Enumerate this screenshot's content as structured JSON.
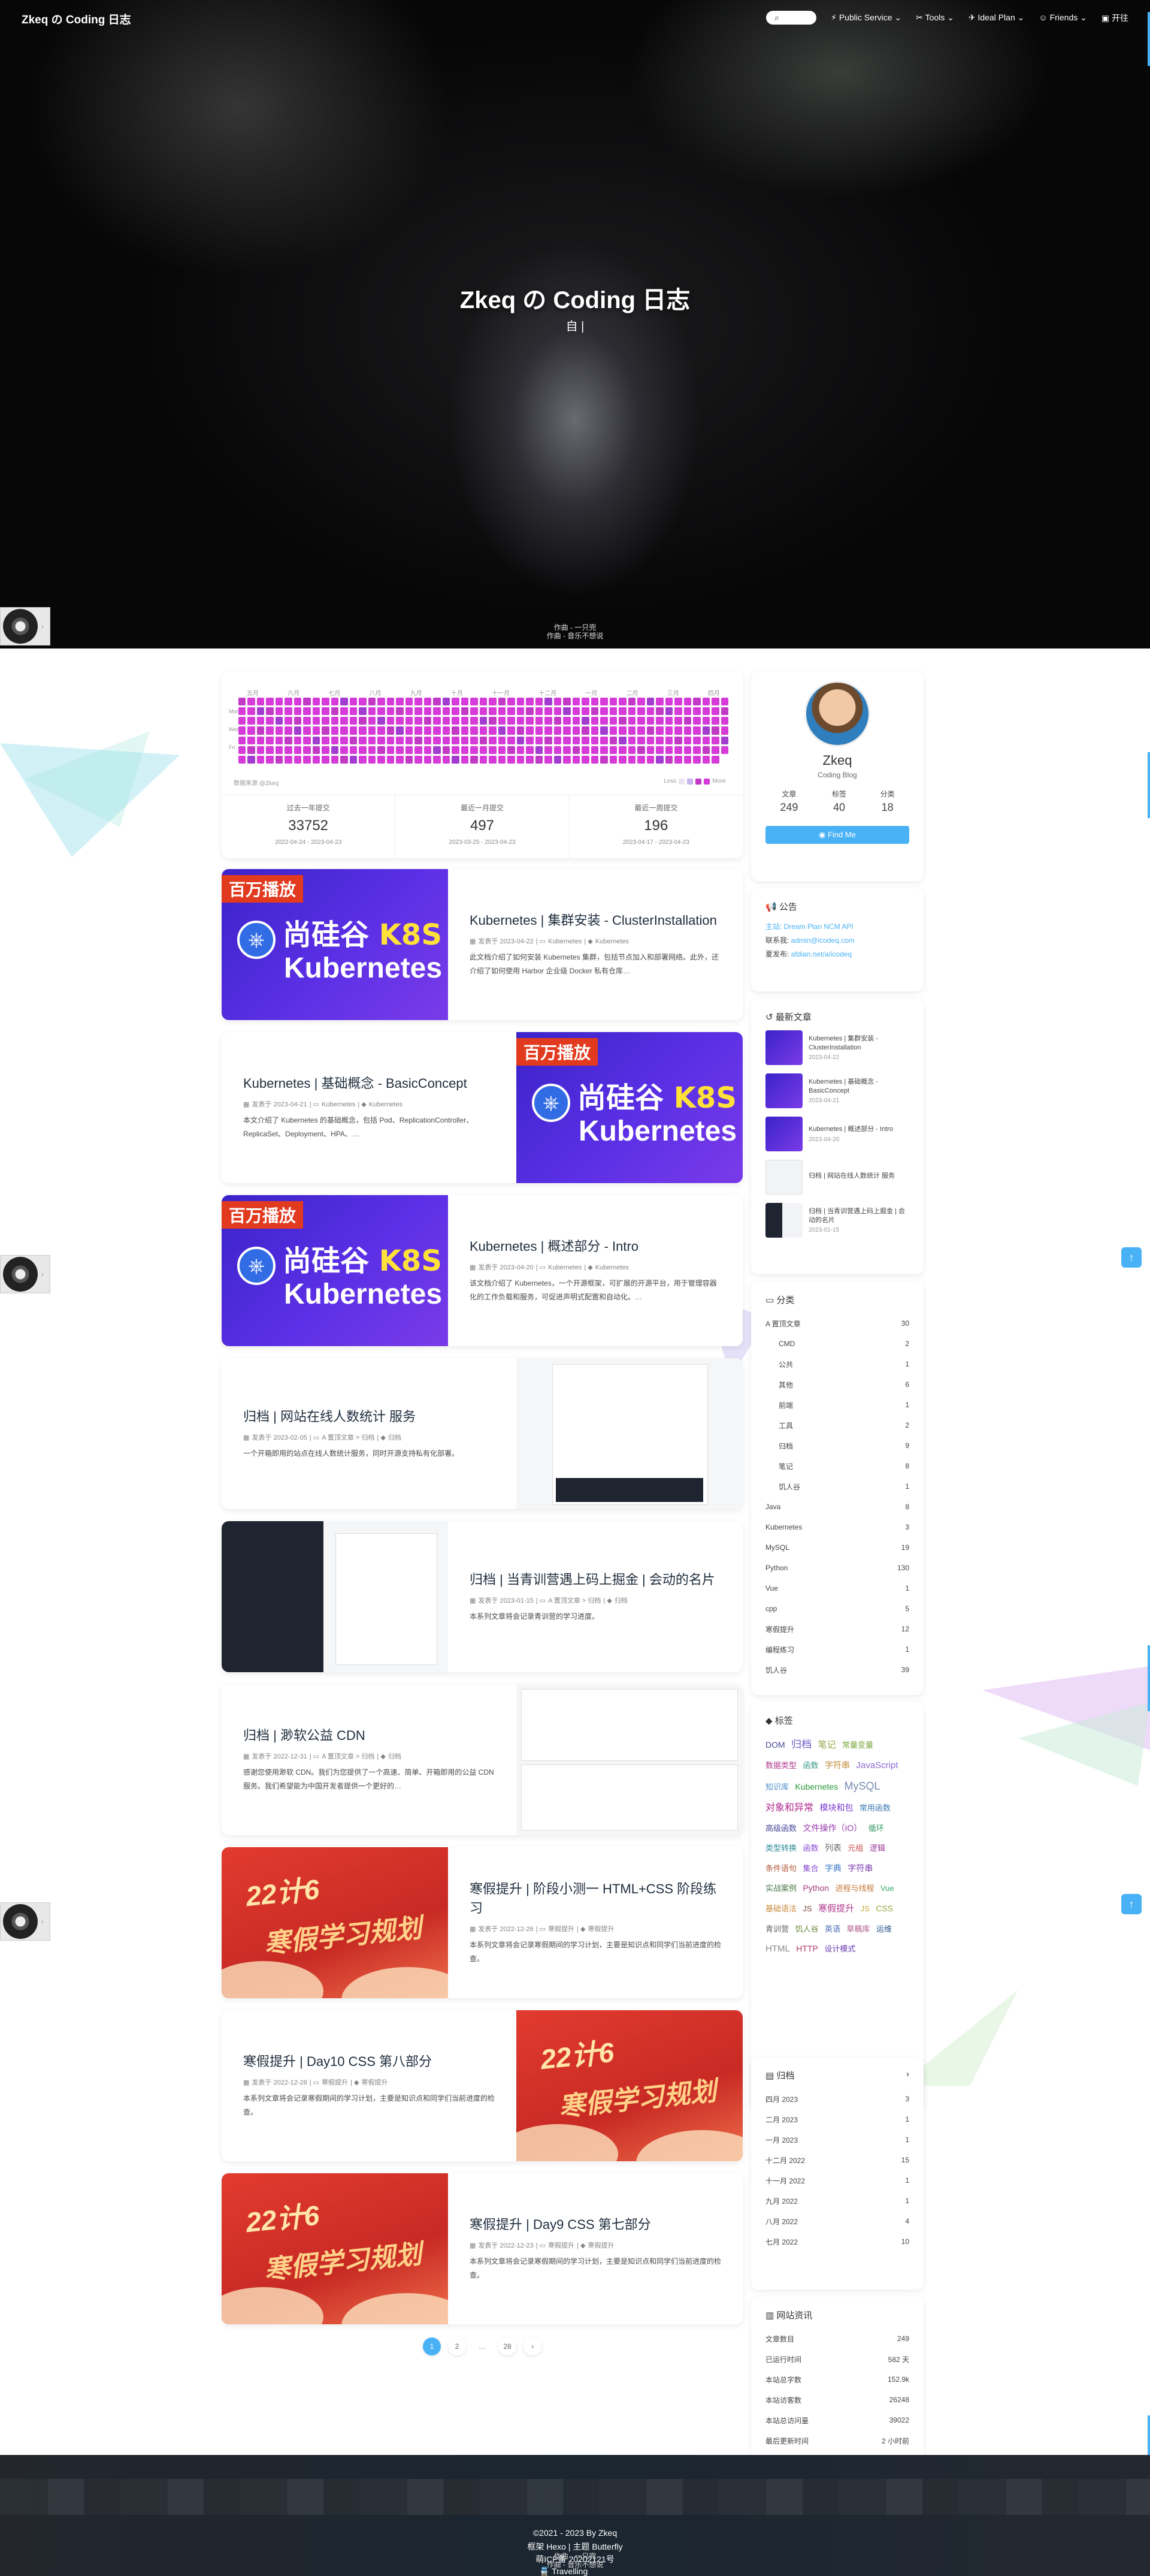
{
  "nav": {
    "site_name": "Zkeq の Coding 日志",
    "search": "Search",
    "menus": [
      "Public Service",
      "Tools",
      "Ideal Plan",
      "Friends",
      "开往"
    ]
  },
  "hero": {
    "title": "Zkeq の Coding 日志",
    "subtitle": "自 |",
    "foot1": "作曲 - 一只兜",
    "foot2": "作曲 - 音乐不想说"
  },
  "heatmap": {
    "months": [
      "五月",
      "六月",
      "七月",
      "八月",
      "九月",
      "十月",
      "十一月",
      "十二月",
      "一月",
      "二月",
      "三月",
      "四月"
    ],
    "days": [
      "Mon",
      "Wed",
      "Fri"
    ],
    "source": "数据来源 @Zkeq",
    "less": "Less",
    "more": "More",
    "stats": [
      {
        "title": "过去一年提交",
        "value": "33752",
        "range": "2022-04-24 - 2023-04-23"
      },
      {
        "title": "最近一月提交",
        "value": "497",
        "range": "2023-03-25 - 2023-04-23"
      },
      {
        "title": "最近一周提交",
        "value": "196",
        "range": "2023-04-17 - 2023-04-23"
      }
    ]
  },
  "posts": [
    {
      "title": "Kubernetes | 集群安装 - ClusterInstallation",
      "date": "发表于 2023-04-22",
      "cat": "Kubernetes",
      "tag": "Kubernetes",
      "excerpt": "此文档介绍了如何安装 Kubernetes 集群，包括节点加入和部署网络。此外，还介绍了如何使用 Harbor 企业级 Docker 私有仓库…"
    },
    {
      "title": "Kubernetes | 基础概念 - BasicConcept",
      "date": "发表于 2023-04-21",
      "cat": "Kubernetes",
      "tag": "Kubernetes",
      "excerpt": "本文介绍了 Kubernetes 的基础概念，包括 Pod、ReplicationController、ReplicaSet、Deployment、HPA、…"
    },
    {
      "title": "Kubernetes | 概述部分 - Intro",
      "date": "发表于 2023-04-20",
      "cat": "Kubernetes",
      "tag": "Kubernetes",
      "excerpt": "该文档介绍了 Kubernetes，一个开源框架，可扩展的开源平台，用于管理容器化的工作负载和服务，可促进声明式配置和自动化。…"
    },
    {
      "title": "归档 | 网站在线人数统计 服务",
      "date": "发表于 2023-02-05",
      "cat": "A 置顶文章 > 归档",
      "tag": "归档",
      "excerpt": "一个开箱即用的站点在线人数统计服务，同时开源支持私有化部署。"
    },
    {
      "title": "归档 | 当青训营遇上码上掘金 | 会动的名片",
      "date": "发表于 2023-01-15",
      "cat": "A 置顶文章 > 归档",
      "tag": "归档",
      "excerpt": "本系列文章将会记录青训营的学习进度。"
    },
    {
      "title": "归档 | 渺软公益 CDN",
      "date": "发表于 2022-12-31",
      "cat": "A 置顶文章 > 归档",
      "tag": "归档",
      "excerpt": "感谢您使用渺软 CDN。我们为您提供了一个高速、简单、开箱即用的公益 CDN 服务。我们希望能为中国开发者提供一个更好的…"
    },
    {
      "title": "寒假提升 | 阶段小测一 HTML+CSS 阶段练习",
      "date": "发表于 2022-12-26",
      "cat": "寒假提升",
      "tag": "寒假提升",
      "excerpt": "本系列文章将会记录寒假期间的学习计划，主要是知识点和同学们当前进度的检查。"
    },
    {
      "title": "寒假提升 | Day10 CSS 第八部分",
      "date": "发表于 2022-12-28",
      "cat": "寒假提升",
      "tag": "寒假提升",
      "excerpt": "本系列文章将会记录寒假期间的学习计划，主要是知识点和同学们当前进度的检查。"
    },
    {
      "title": "寒假提升 | Day9 CSS 第七部分",
      "date": "发表于 2022-12-23",
      "cat": "寒假提升",
      "tag": "寒假提升",
      "excerpt": "本系列文章将会记录寒假期间的学习计划，主要是知识点和同学们当前进度的检查。"
    }
  ],
  "images": {
    "k8s_badge": "百万播放",
    "k8s_brand": "尚硅谷",
    "k8s_title": "K8S",
    "k8s_sub": "Kubernetes",
    "winter1": "22计6",
    "winter2": "寒假学习规划"
  },
  "pager": [
    "1",
    "2",
    "…",
    "28",
    "›"
  ],
  "author": {
    "name": "Zkeq",
    "desc": "Coding Blog",
    "stats": [
      {
        "label": "文章",
        "value": "249"
      },
      {
        "label": "标签",
        "value": "40"
      },
      {
        "label": "分类",
        "value": "18"
      }
    ],
    "follow": "Find Me"
  },
  "announcement": {
    "title": "公告",
    "line1": "主站: Dream Plan  NCM API",
    "line2_label": "联系我: ",
    "line2": "admin@icodeq.com",
    "line3_label": "夏发布: ",
    "line3": "afdian.net/a/icodeq"
  },
  "recent": {
    "title": "最新文章",
    "items": [
      {
        "title": "Kubernetes | 集群安装 - ClusterInstallation",
        "date": "2023-04-22"
      },
      {
        "title": "Kubernetes | 基础概念 - BasicConcept",
        "date": "2023-04-21"
      },
      {
        "title": "Kubernetes | 概述部分 - Intro",
        "date": "2023-04-20"
      },
      {
        "title": "归档 | 网站在线人数统计 服务",
        "date": ""
      },
      {
        "title": "归档 | 当青训营遇上码上掘金 | 会动的名片",
        "date": "2023-01-15"
      }
    ]
  },
  "categories": {
    "title": "分类",
    "items": [
      {
        "name": "A 置顶文章",
        "count": "30",
        "sub": false
      },
      {
        "name": "CMD",
        "count": "2",
        "sub": true
      },
      {
        "name": "公共",
        "count": "1",
        "sub": true
      },
      {
        "name": "其他",
        "count": "6",
        "sub": true
      },
      {
        "name": "前端",
        "count": "1",
        "sub": true
      },
      {
        "name": "工具",
        "count": "2",
        "sub": true
      },
      {
        "name": "归档",
        "count": "9",
        "sub": true
      },
      {
        "name": "笔记",
        "count": "8",
        "sub": true
      },
      {
        "name": "饥人谷",
        "count": "1",
        "sub": true
      },
      {
        "name": "Java",
        "count": "8",
        "sub": false
      },
      {
        "name": "Kubernetes",
        "count": "3",
        "sub": false
      },
      {
        "name": "MySQL",
        "count": "19",
        "sub": false
      },
      {
        "name": "Python",
        "count": "130",
        "sub": false
      },
      {
        "name": "Vue",
        "count": "1",
        "sub": false
      },
      {
        "name": "cpp",
        "count": "5",
        "sub": false
      },
      {
        "name": "寒假提升",
        "count": "12",
        "sub": false
      },
      {
        "name": "编程练习",
        "count": "1",
        "sub": false
      },
      {
        "name": "饥人谷",
        "count": "39",
        "sub": false
      }
    ]
  },
  "tags": {
    "title": "标签",
    "items": [
      {
        "name": "DOM",
        "color": "#4a4a9a",
        "size": "14"
      },
      {
        "name": "归档",
        "color": "#6d58c9",
        "size": "17"
      },
      {
        "name": "笔记",
        "color": "#9aa64a",
        "size": "15"
      },
      {
        "name": "常量变量",
        "color": "#7aa83c",
        "size": "13"
      },
      {
        "name": "数据类型",
        "color": "#b03a8e",
        "size": "13"
      },
      {
        "name": "函数",
        "color": "#3a9a8a",
        "size": "13"
      },
      {
        "name": "字符串",
        "color": "#c38a3a",
        "size": "14"
      },
      {
        "name": "JavaScript",
        "color": "#8a6bd4",
        "size": "15"
      },
      {
        "name": "知识库",
        "color": "#4a8ac8",
        "size": "13"
      },
      {
        "name": "Kubernetes",
        "color": "#2a9a3a",
        "size": "14"
      },
      {
        "name": "MySQL",
        "color": "#7a8ab0",
        "size": "18"
      },
      {
        "name": "对象和异常",
        "color": "#b02a8e",
        "size": "16"
      },
      {
        "name": "模块和包",
        "color": "#7a3ad4",
        "size": "14"
      },
      {
        "name": "常用函数",
        "color": "#3a7ab0",
        "size": "13"
      },
      {
        "name": "高级函数",
        "color": "#4a4a9a",
        "size": "13"
      },
      {
        "name": "文件操作（IO）",
        "color": "#9a3ab0",
        "size": "14"
      },
      {
        "name": "循环",
        "color": "#3a9a6a",
        "size": "13"
      },
      {
        "name": "类型转换",
        "color": "#2a8a9a",
        "size": "13"
      },
      {
        "name": "函数",
        "color": "#8a4ad4",
        "size": "13"
      },
      {
        "name": "列表",
        "color": "#6a6a6a",
        "size": "14"
      },
      {
        "name": "元组",
        "color": "#c84a4a",
        "size": "13"
      },
      {
        "name": "逻辑",
        "color": "#9a3a9a",
        "size": "13"
      },
      {
        "name": "条件语句",
        "color": "#b05a3a",
        "size": "13"
      },
      {
        "name": "集合",
        "color": "#8a4ad4",
        "size": "13"
      },
      {
        "name": "字典",
        "color": "#3a7ac8",
        "size": "14"
      },
      {
        "name": "字符串",
        "color": "#7a3ab0",
        "size": "14"
      },
      {
        "name": "实战案例",
        "color": "#4a7a4a",
        "size": "13"
      },
      {
        "name": "Python",
        "color": "#a03a7a",
        "size": "14"
      },
      {
        "name": "进程与线程",
        "color": "#c87a3a",
        "size": "13"
      },
      {
        "name": "Vue",
        "color": "#3aaa6a",
        "size": "13"
      },
      {
        "name": "基础语法",
        "color": "#c8883a",
        "size": "13"
      },
      {
        "name": "JS",
        "color": "#7a4a3a",
        "size": "13"
      },
      {
        "name": "寒假提升",
        "color": "#b03a8e",
        "size": "15"
      },
      {
        "name": "JS",
        "color": "#c8a83a",
        "size": "13"
      },
      {
        "name": "CSS",
        "color": "#9aa63a",
        "size": "14"
      },
      {
        "name": "青训营",
        "color": "#6a6a6a",
        "size": "13"
      },
      {
        "name": "饥人谷",
        "color": "#6a8a3a",
        "size": "13"
      },
      {
        "name": "英语",
        "color": "#4a6ab0",
        "size": "13"
      },
      {
        "name": "草稿库",
        "color": "#b05a8a",
        "size": "13"
      },
      {
        "name": "运维",
        "color": "#2a5a8a",
        "size": "13"
      },
      {
        "name": "HTML",
        "color": "#8a8a8a",
        "size": "15"
      },
      {
        "name": "HTTP",
        "color": "#b03a6a",
        "size": "14"
      },
      {
        "name": "设计模式",
        "color": "#6a3ab0",
        "size": "13"
      }
    ]
  },
  "archives": {
    "title": "归档",
    "items": [
      {
        "name": "四月 2023",
        "count": "3"
      },
      {
        "name": "二月 2023",
        "count": "1"
      },
      {
        "name": "一月 2023",
        "count": "1"
      },
      {
        "name": "十二月 2022",
        "count": "15"
      },
      {
        "name": "十一月 2022",
        "count": "1"
      },
      {
        "name": "九月 2022",
        "count": "1"
      },
      {
        "name": "八月 2022",
        "count": "4"
      },
      {
        "name": "七月 2022",
        "count": "10"
      }
    ]
  },
  "siteinfo": {
    "title": "网站资讯",
    "items": [
      {
        "name": "文章数目",
        "value": "249"
      },
      {
        "name": "已运行时间",
        "value": "582 天"
      },
      {
        "name": "本站总字数",
        "value": "152.9k"
      },
      {
        "name": "本站访客数",
        "value": "26248"
      },
      {
        "name": "本站总访问量",
        "value": "39022"
      },
      {
        "name": "最后更新时间",
        "value": "2 小时前"
      }
    ]
  },
  "footer": {
    "line1": "©2021 - 2023 By Zkeq",
    "line2": "框架 Hexo | 主题 Butterfly",
    "line3": "萌ICP备 20202121号",
    "player": "作曲 - 一只兜",
    "player2": "作曲 - 音乐不想说",
    "travel": "Travelling"
  }
}
